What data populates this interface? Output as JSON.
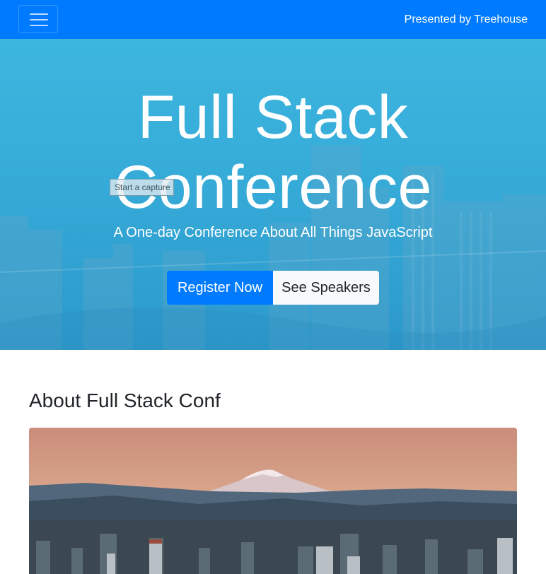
{
  "navbar": {
    "brand": "Presented by Treehouse",
    "toggle_icon": "hamburger-menu-icon",
    "color": "#007bff"
  },
  "hero": {
    "title_line1": "Full Stack",
    "title_line2": "Conference",
    "subtitle": "A One-day Conference About All Things JavaScript",
    "register_label": "Register Now",
    "speakers_label": "See Speakers",
    "background": "city skyline photo with blue overlay"
  },
  "tooltip": {
    "text": "Start a capture"
  },
  "about": {
    "title": "About Full Stack Conf",
    "image": "Portland skyline with Mount Hood at sunset"
  }
}
